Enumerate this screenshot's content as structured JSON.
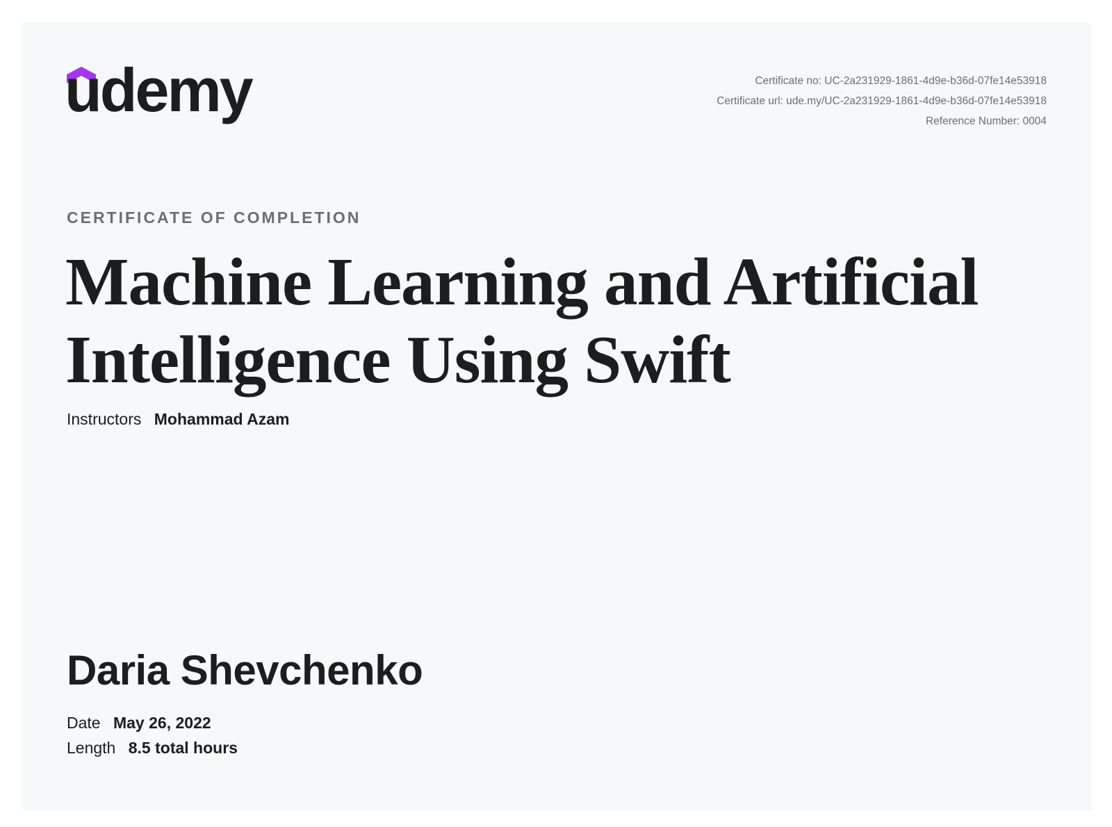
{
  "brand": {
    "logo_text": "udemy",
    "accent_color": "#a435f0",
    "text_color": "#1c1d1f"
  },
  "meta": {
    "certificate_no": "Certificate no: UC-2a231929-1861-4d9e-b36d-07fe14e53918",
    "certificate_url": "Certificate url: ude.my/UC-2a231929-1861-4d9e-b36d-07fe14e53918",
    "reference_number": "Reference Number: 0004"
  },
  "certificate": {
    "eyebrow": "CERTIFICATE OF COMPLETION",
    "course_title": "Machine Learning and Artificial Intelligence Using Swift",
    "instructors_label": "Instructors",
    "instructors_value": "Mohammad Azam",
    "recipient_name": "Daria Shevchenko",
    "date_label": "Date",
    "date_value": "May 26, 2022",
    "length_label": "Length",
    "length_value": "8.5 total hours"
  }
}
